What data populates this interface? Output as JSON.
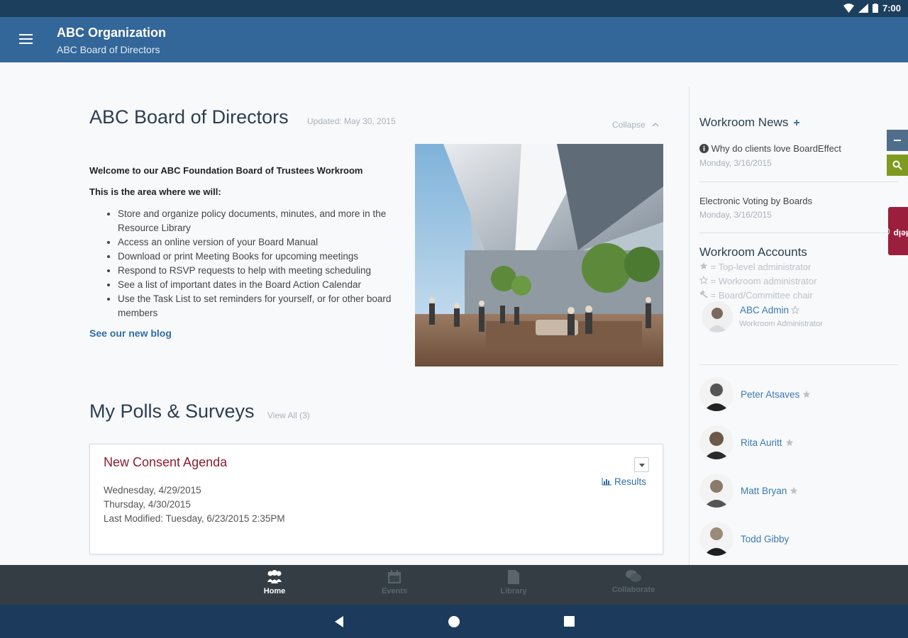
{
  "status_bar": {
    "time": "7:00"
  },
  "app_bar": {
    "title": "ABC Organization",
    "subtitle": "ABC Board of Directors"
  },
  "workroom": {
    "title": "ABC Board of Directors",
    "updated": "Updated: May 30, 2015",
    "collapse_label": "Collapse",
    "welcome": "Welcome to our ABC Foundation Board of Trustees Workroom",
    "area_intro": "This is the area where we will:",
    "bullets": [
      "Store and organize policy documents, minutes, and more in the Resource Library",
      "Access an online version of your Board Manual",
      "Download or print Meeting Books for upcoming meetings",
      "Respond to RSVP requests to help with meeting scheduling",
      "See a list of important dates in the Board Action Calendar",
      "Use the Task List to set reminders for yourself, or for other board members"
    ],
    "blog_link": "See our new blog"
  },
  "polls": {
    "title": "My Polls & Surveys",
    "view_all": "View All (3)",
    "card": {
      "title": "New Consent Agenda",
      "line1": "Wednesday, 4/29/2015",
      "line2": "Thursday, 4/30/2015",
      "line3": "Last Modified: Tuesday, 6/23/2015 2:35PM",
      "results_label": "Results"
    }
  },
  "sidebar": {
    "news_title": "Workroom News",
    "news": [
      {
        "title": "Why do clients love BoardEffect",
        "date": "Monday, 3/16/2015"
      },
      {
        "title": "Electronic Voting by Boards",
        "date": "Monday, 3/16/2015"
      }
    ],
    "accounts_title": "Workroom Accounts",
    "legend": [
      "= Top-level administrator",
      "= Workroom administrator",
      "= Board/Committee chair"
    ],
    "admin": {
      "name": "ABC Admin",
      "role": "Workroom Administrator"
    },
    "members": [
      {
        "name": "Peter Atsaves"
      },
      {
        "name": "Rita Auritt"
      },
      {
        "name": "Matt Bryan"
      },
      {
        "name": "Todd Gibby"
      }
    ],
    "help_label": "Help"
  },
  "bottom_nav": [
    {
      "label": "Home",
      "icon": "people-icon",
      "active": true
    },
    {
      "label": "Events",
      "icon": "calendar-icon",
      "active": false
    },
    {
      "label": "Library",
      "icon": "document-icon",
      "active": false
    },
    {
      "label": "Collaborate",
      "icon": "chat-icon",
      "active": false
    }
  ],
  "colors": {
    "app_bar": "#336699",
    "poll_title": "#8c1c33",
    "link": "#2f6ea3",
    "help_tab": "#9b1e3d",
    "search_tab": "#7f9a1f"
  }
}
